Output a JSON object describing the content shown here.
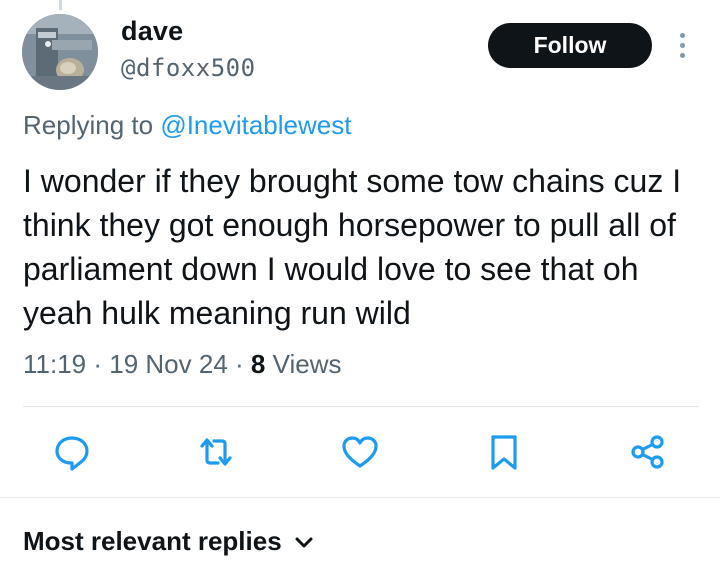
{
  "author": {
    "display_name": "dave",
    "handle": "@dfoxx500",
    "avatar": "avatar-photo"
  },
  "follow_label": "Follow",
  "more_icon": "more-vertical-icon",
  "reply_context": {
    "prefix": "Replying to ",
    "mention": "@Inevitablewest"
  },
  "tweet": {
    "text": "I wonder if they brought some tow chains cuz I think they got enough horsepower to pull all of parliament down I would love to see that oh yeah hulk meaning run wild"
  },
  "meta": {
    "time": "11:19",
    "separator": " · ",
    "date": "19 Nov 24",
    "views_count": "8",
    "views_label": " Views"
  },
  "actions": [
    {
      "name": "reply",
      "icon": "reply-icon"
    },
    {
      "name": "retweet",
      "icon": "retweet-icon"
    },
    {
      "name": "like",
      "icon": "heart-icon"
    },
    {
      "name": "bookmark",
      "icon": "bookmark-icon"
    },
    {
      "name": "share",
      "icon": "share-icon"
    }
  ],
  "replies_sort": {
    "label": "Most relevant replies",
    "icon": "chevron-down-icon"
  },
  "colors": {
    "text": "#0f1419",
    "secondary": "#536471",
    "accent": "#1d9bf0",
    "icon": "#1d9bf0",
    "button_bg": "#0f1419"
  }
}
